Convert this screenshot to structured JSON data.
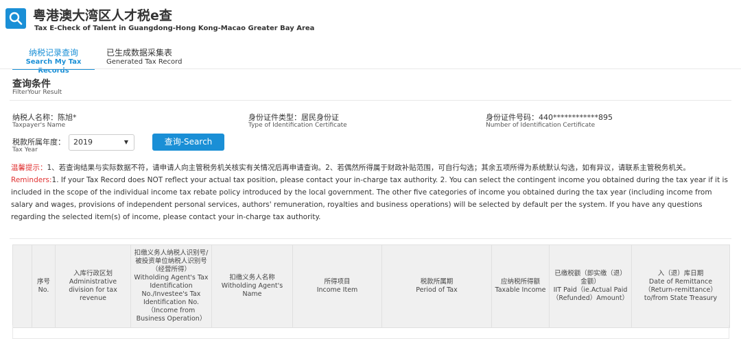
{
  "colors": {
    "accent": "#1a8fd6",
    "warning": "#e03131",
    "header_bg": "#f0f0f0"
  },
  "header": {
    "logo_icon": "search-icon",
    "title_cn": "粤港澳大湾区人才税e查",
    "title_en": "Tax E-Check of Talent in Guangdong-Hong Kong-Macao Greater Bay Area"
  },
  "tabs": [
    {
      "cn": "纳税记录查询",
      "en": "Search My Tax Records",
      "active": true
    },
    {
      "cn": "已生成数据采集表",
      "en": "Generated Tax Record",
      "active": false
    }
  ],
  "filter": {
    "title_cn": "查询条件",
    "title_en": "FilterYour Result",
    "taxpayer_name": {
      "cn": "纳税人名称：陈旭*",
      "en": "Taxpayer's Name"
    },
    "id_type": {
      "cn": "身份证件类型：居民身份证",
      "en": "Type of Identification Certificate"
    },
    "id_number": {
      "cn": "身份证件号码：440************895",
      "en": "Number of Identification Certificate"
    },
    "tax_year": {
      "cn": "税款所属年度：",
      "en": "Tax Year",
      "value": "2019"
    },
    "search_button": "查询-Search"
  },
  "notice": {
    "label_cn": "温馨提示：",
    "text_cn": "1、若查询结果与实际数据不符，请申请人向主管税务机关核实有关情况后再申请查询。2、若偶然所得属于财政补贴范围，可自行勾选；其余五项所得为系统默认勾选，如有异议，请联系主管税务机关。",
    "label_en": "Reminders:",
    "text_en": "1. If your Tax Record does NOT reflect your actual tax position, please contact your in-charge tax authority. 2. You can select the contingent income you obtained during the tax year if it is included in the scope of the individual income tax rebate policy introduced by the local government. The other five categories of income you obtained during the tax year (including income from salary and wages, provisions of independent personal services, authors' remuneration, royalties and business operations) will be selected by default per the system. If you have any questions regarding the selected item(s) of income, please contact your in-charge tax authority."
  },
  "table": {
    "headers": [
      {
        "cn": "",
        "en": ""
      },
      {
        "cn": "序号",
        "en": "No."
      },
      {
        "cn": "入库行政区划",
        "en": "Administrative division for tax revenue"
      },
      {
        "cn": "扣缴义务人纳税人识别号/被投资单位纳税人识别号（经营所得）",
        "en": "Witholding Agent's Tax Identification No./Investee's Tax Identification No.（Income from Business Operation）"
      },
      {
        "cn": "扣缴义务人名称",
        "en": "Witholding Agent's Name"
      },
      {
        "cn": "所得项目",
        "en": "Income Item"
      },
      {
        "cn": "税款所属期",
        "en": "Period of Tax"
      },
      {
        "cn": "应纳税所得额",
        "en": "Taxable Income"
      },
      {
        "cn": "已缴税额（即实缴（退）金额）",
        "en": "IIT Paid（ie.Actual Paid（Refunded）Amount）"
      },
      {
        "cn": "入（退）库日期",
        "en": "Date of Remittance（Return-remittance）to/from State Treasury"
      }
    ]
  }
}
